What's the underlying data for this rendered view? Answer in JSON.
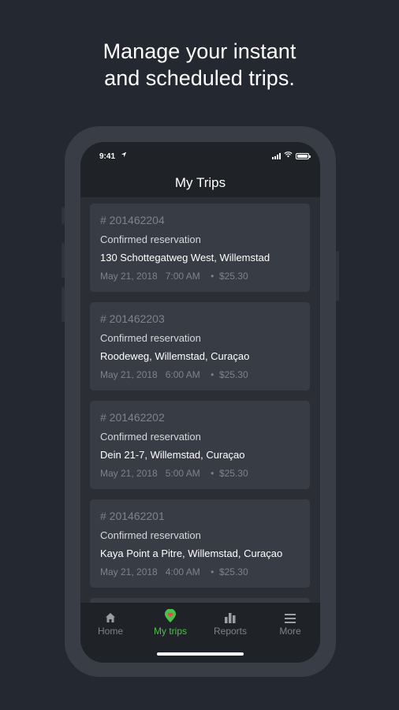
{
  "headline": {
    "line1": "Manage your instant",
    "line2": "and scheduled trips."
  },
  "status_bar": {
    "time": "9:41",
    "icons": [
      "location-arrow-icon",
      "signal-icon",
      "wifi-icon",
      "battery-icon"
    ]
  },
  "screen_title": "My Trips",
  "trips": [
    {
      "number": "# 201462204",
      "status": "Confirmed reservation",
      "address": "130 Schottegatweg West, Willemstad",
      "meta": "May 21, 2018   7:00 AM    •  $25.30"
    },
    {
      "number": "# 201462203",
      "status": "Confirmed reservation",
      "address": "Roodeweg, Willemstad, Curaçao",
      "meta": "May 21, 2018   6:00 AM    •  $25.30"
    },
    {
      "number": "# 201462202",
      "status": "Confirmed reservation",
      "address": "Dein 21-7, Willemstad, Curaçao",
      "meta": "May 21, 2018   5:00 AM    •  $25.30"
    },
    {
      "number": "# 201462201",
      "status": "Confirmed reservation",
      "address": "Kaya Point a Pitre, Willemstad, Curaçao",
      "meta": "May 21, 2018   4:00 AM    •  $25.30"
    }
  ],
  "tabs": [
    {
      "label": "Home",
      "icon": "home-icon"
    },
    {
      "label": "My trips",
      "icon": "map-pin-heart-icon",
      "active": true
    },
    {
      "label": "Reports",
      "icon": "bar-chart-icon"
    },
    {
      "label": "More",
      "icon": "menu-icon"
    }
  ],
  "colors": {
    "background": "#242830",
    "phone_frame": "#393d45",
    "card": "#383c44",
    "accent_green": "#4cc04a"
  }
}
